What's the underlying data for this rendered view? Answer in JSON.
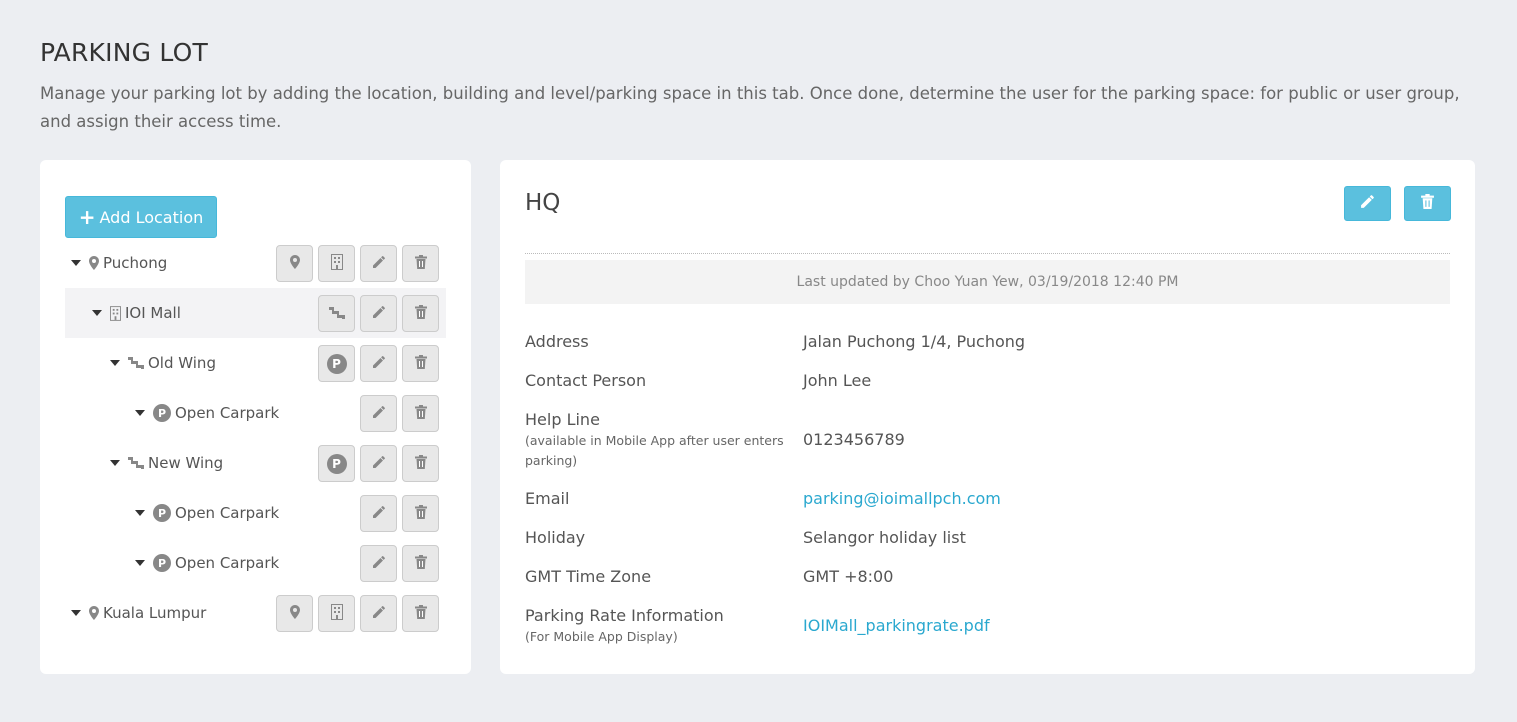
{
  "page": {
    "title": "PARKING LOT",
    "description": "Manage your parking lot by adding the location, building and level/parking space in this tab. Once done, determine the user for the parking space: for public or user group, and assign their access time."
  },
  "tree": {
    "add_label": "Add Location",
    "add_plus": "+",
    "nodes": [
      {
        "label": "Puchong",
        "p": ""
      },
      {
        "label": "IOI Mall",
        "p": ""
      },
      {
        "label": "Old Wing",
        "p": "P"
      },
      {
        "label": "Open Carpark",
        "p": "P"
      },
      {
        "label": "New Wing",
        "p": "P"
      },
      {
        "label": "Open Carpark",
        "p": "P"
      },
      {
        "label": "Open Carpark",
        "p": "P"
      },
      {
        "label": "Kuala Lumpur",
        "p": ""
      }
    ]
  },
  "detail": {
    "title": "HQ",
    "updated": "Last updated by Choo Yuan Yew, 03/19/2018 12:40 PM",
    "fields": [
      {
        "label": "Address",
        "sub": "",
        "value": "Jalan Puchong 1/4, Puchong"
      },
      {
        "label": "Contact Person",
        "sub": "",
        "value": "John Lee"
      },
      {
        "label": "Help Line",
        "sub": "(available in Mobile App after user enters parking)",
        "value": "0123456789"
      },
      {
        "label": "Email",
        "sub": "",
        "value": "parking@ioimallpch.com"
      },
      {
        "label": "Holiday",
        "sub": "",
        "value": "Selangor holiday list"
      },
      {
        "label": "GMT Time Zone",
        "sub": "",
        "value": "GMT +8:00"
      },
      {
        "label": "Parking Rate Information",
        "sub": "(For Mobile App Display)",
        "value": "IOIMall_parkingrate.pdf"
      }
    ]
  },
  "colors": {
    "accent": "#5bc0de",
    "link": "#2aa8cf",
    "background": "#eceef2"
  }
}
